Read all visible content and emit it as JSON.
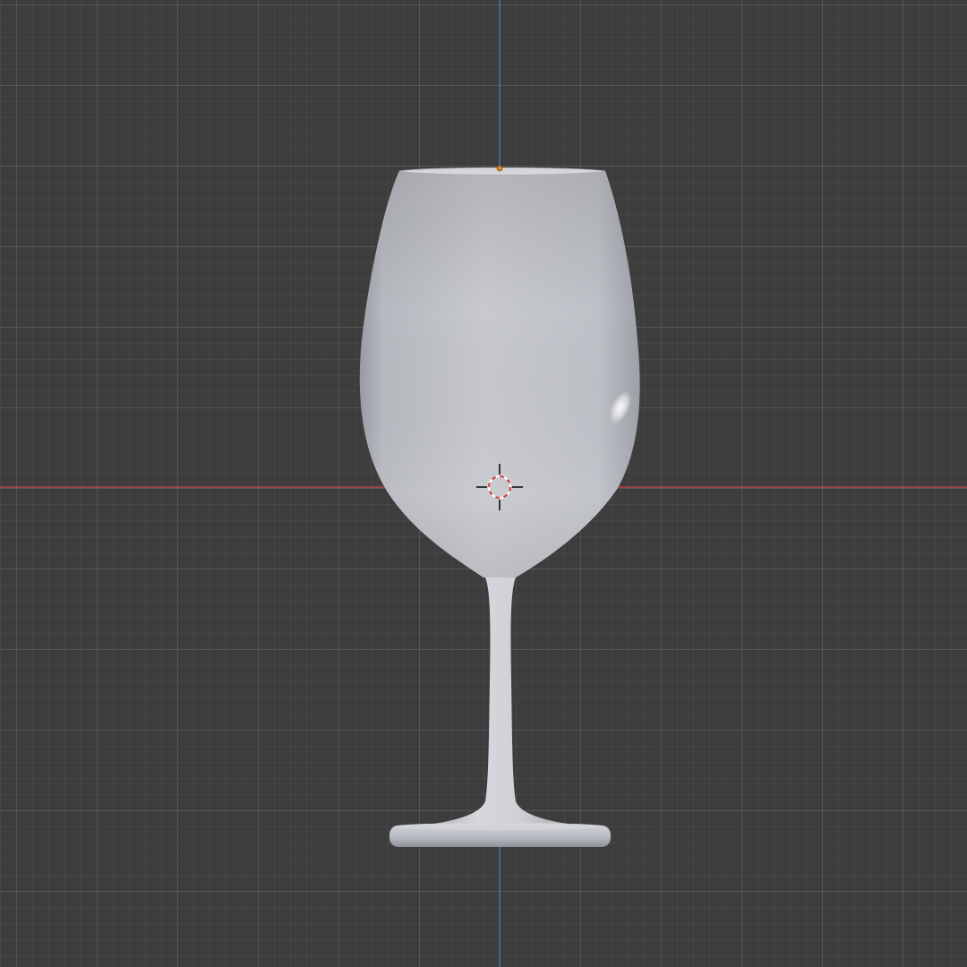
{
  "viewport": {
    "type": "3d-viewport-front-orthographic",
    "background_color": "#3d3d3d",
    "grid": true,
    "x_axis_color": "#b0484e",
    "z_axis_color": "#3f6fa6"
  },
  "scene": {
    "object": {
      "name": "wine-glass",
      "material_color": "#c4c6cc",
      "shading": "solid"
    },
    "origin_color": "#e08a1e",
    "cursor_3d": {
      "colors": [
        "#d23a3a",
        "#ffffff",
        "#111111"
      ]
    }
  }
}
